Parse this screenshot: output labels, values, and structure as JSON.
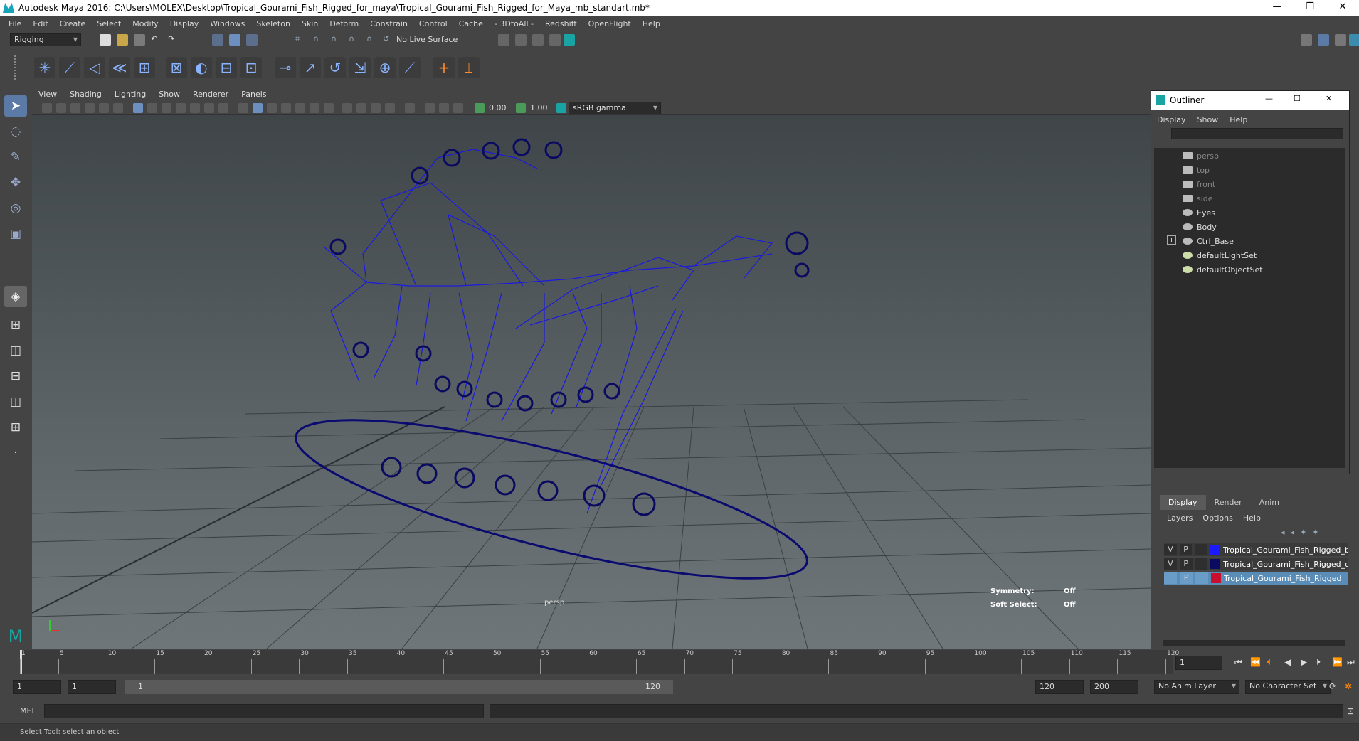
{
  "window": {
    "title": "Autodesk Maya 2016: C:\\Users\\MOLEX\\Desktop\\Tropical_Gourami_Fish_Rigged_for_maya\\Tropical_Gourami_Fish_Rigged_for_Maya_mb_standart.mb*"
  },
  "menubar": [
    "File",
    "Edit",
    "Create",
    "Select",
    "Modify",
    "Display",
    "Windows",
    "Skeleton",
    "Skin",
    "Deform",
    "Constrain",
    "Control",
    "Cache",
    "- 3DtoAll -",
    "Redshift",
    "OpenFlight",
    "Help"
  ],
  "status": {
    "menuset": "Rigging",
    "live_surface": "No Live Surface"
  },
  "viewport": {
    "menu": [
      "View",
      "Shading",
      "Lighting",
      "Show",
      "Renderer",
      "Panels"
    ],
    "near": "0.00",
    "far": "1.00",
    "colorspace": "sRGB gamma",
    "camera_label": "persp",
    "symmetry_label": "Symmetry:",
    "symmetry_value": "Off",
    "soft_select_label": "Soft Select:",
    "soft_select_value": "Off"
  },
  "outliner": {
    "title": "Outliner",
    "menu": [
      "Display",
      "Show",
      "Help"
    ],
    "items": [
      {
        "label": "persp",
        "icon": "camera-icon",
        "dim": true
      },
      {
        "label": "top",
        "icon": "camera-icon",
        "dim": true
      },
      {
        "label": "front",
        "icon": "camera-icon",
        "dim": true
      },
      {
        "label": "side",
        "icon": "camera-icon",
        "dim": true
      },
      {
        "label": "Eyes",
        "icon": "group-icon",
        "dim": false
      },
      {
        "label": "Body",
        "icon": "group-icon",
        "dim": false
      },
      {
        "label": "Ctrl_Base",
        "icon": "group-icon",
        "dim": false,
        "expandable": true
      },
      {
        "label": "defaultLightSet",
        "icon": "set-icon",
        "dim": false
      },
      {
        "label": "defaultObjectSet",
        "icon": "set-icon",
        "dim": false
      }
    ]
  },
  "layers": {
    "tabs": [
      "Display",
      "Render",
      "Anim"
    ],
    "menu": [
      "Layers",
      "Options",
      "Help"
    ],
    "rows": [
      {
        "v": "V",
        "p": "P",
        "color": "#1a1aff",
        "name": "Tropical_Gourami_Fish_Rigged_b"
      },
      {
        "v": "V",
        "p": "P",
        "color": "#0a0a60",
        "name": "Tropical_Gourami_Fish_Rigged_c"
      },
      {
        "v": "",
        "p": "P",
        "color": "#c8102e",
        "name": "Tropical_Gourami_Fish_Rigged"
      }
    ]
  },
  "timeline": {
    "ticks": [
      "1",
      "5",
      "10",
      "15",
      "20",
      "25",
      "30",
      "35",
      "40",
      "45",
      "50",
      "55",
      "60",
      "65",
      "70",
      "75",
      "80",
      "85",
      "90",
      "95",
      "100",
      "105",
      "110",
      "115",
      "120"
    ],
    "current_frame": "1"
  },
  "range": {
    "start": "1",
    "start_inner": "1",
    "slider_start": "1",
    "slider_end": "120",
    "end_inner": "120",
    "end": "200",
    "anim_layer": "No Anim Layer",
    "character_set": "No Character Set"
  },
  "cmd": {
    "lang": "MEL"
  },
  "help": {
    "text": "Select Tool: select an object"
  }
}
